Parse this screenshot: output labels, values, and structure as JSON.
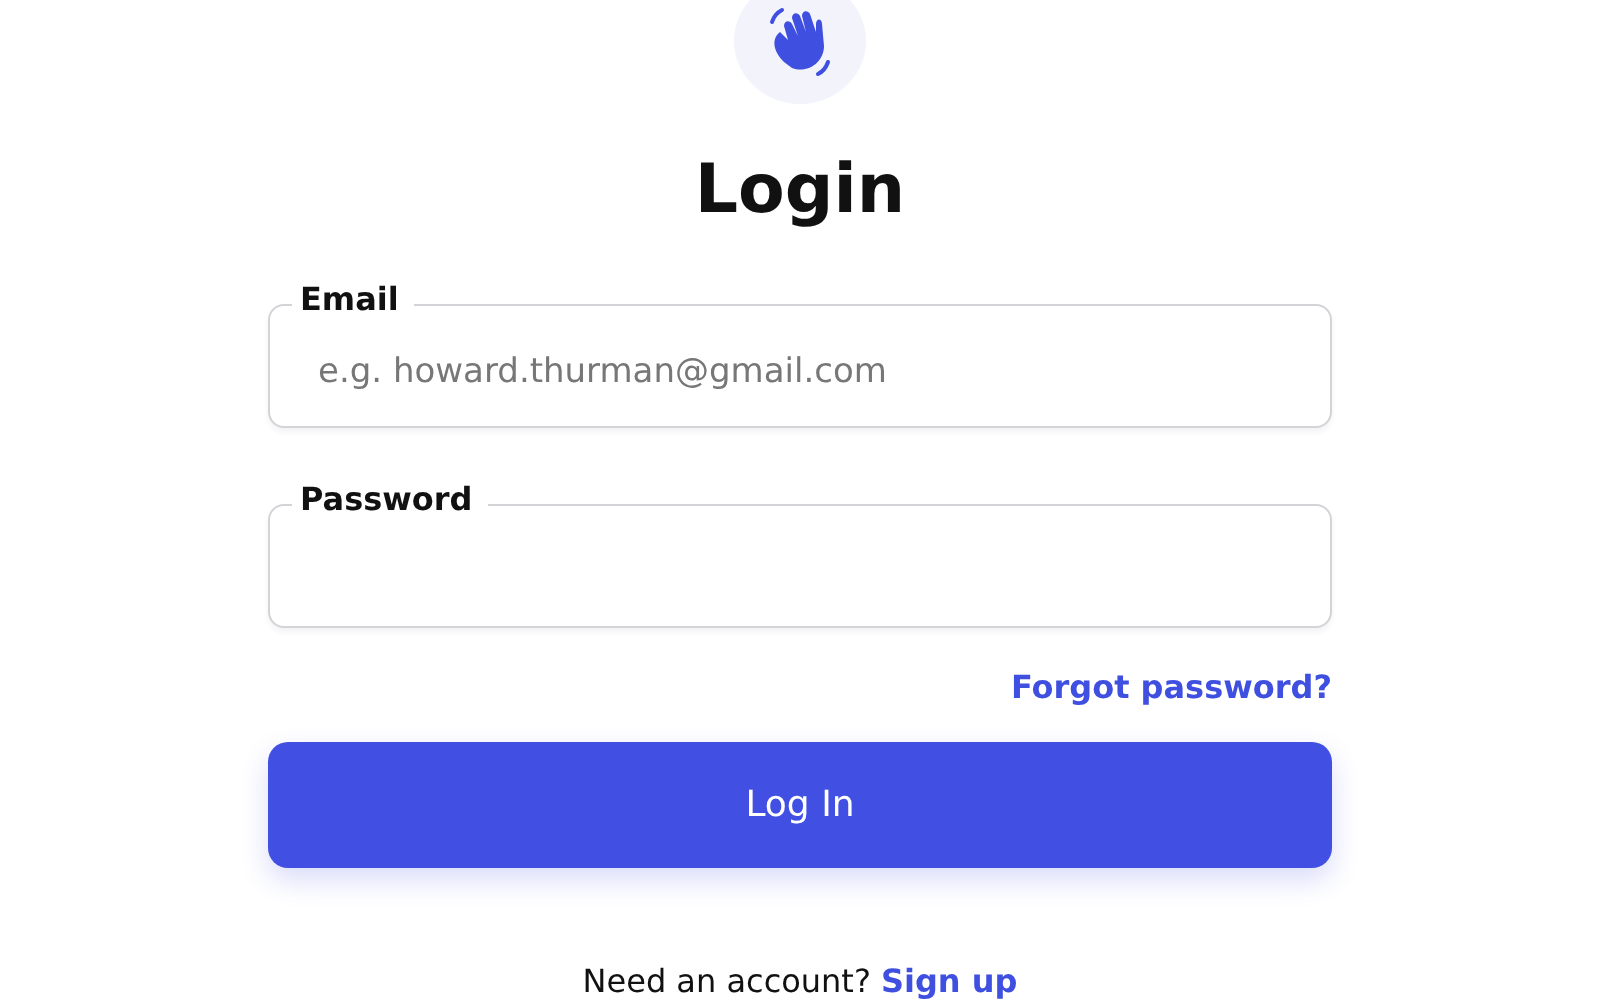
{
  "title": "Login",
  "fields": [
    {
      "label": "Email",
      "placeholder": "e.g. howard.thurman@gmail.com"
    },
    {
      "label": "Password"
    }
  ],
  "forgot_link": "Forgot password?",
  "submit_button": "Log In",
  "signup": {
    "prompt": "Need an account?",
    "link": "Sign up"
  }
}
